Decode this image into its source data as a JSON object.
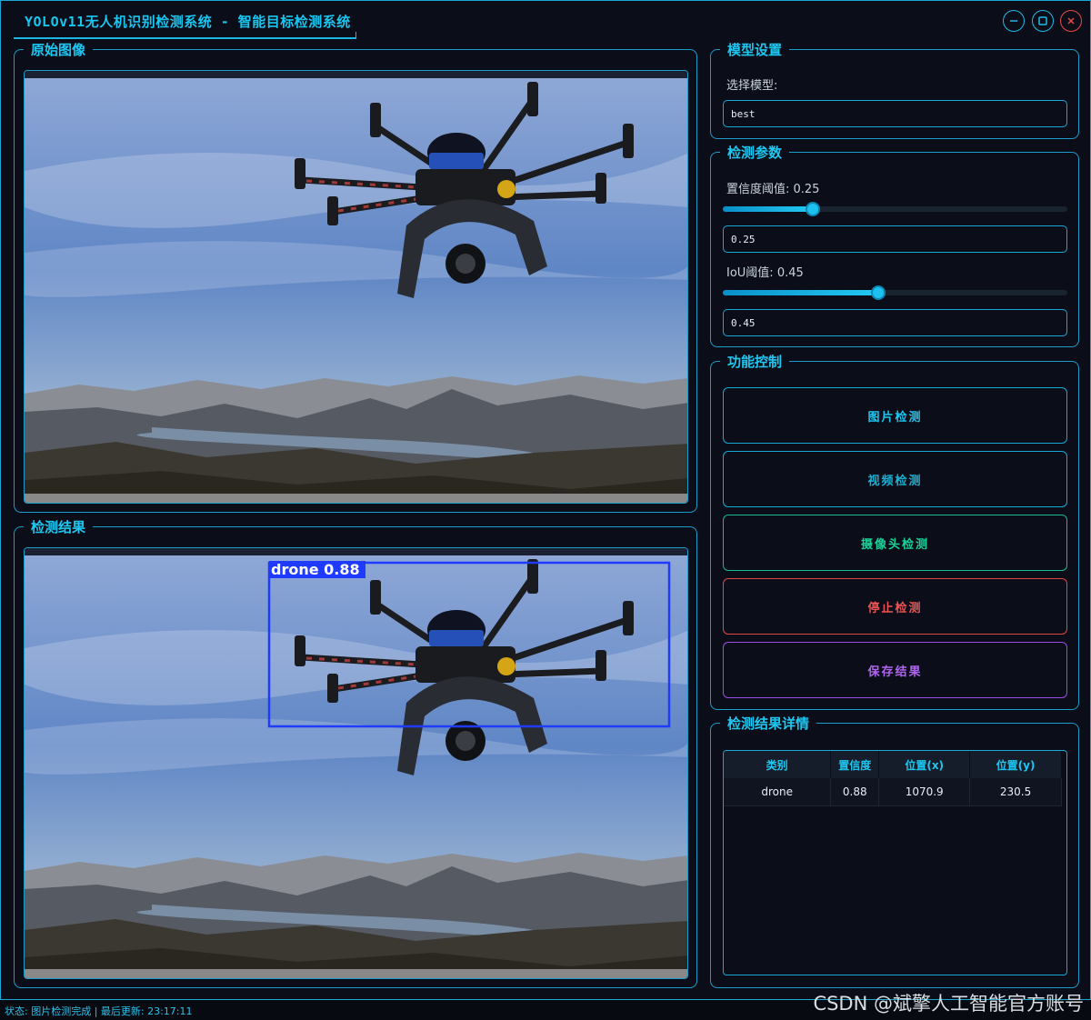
{
  "window": {
    "title": "YOLOv11无人机识别检测系统 - 智能目标检测系统"
  },
  "original_panel": {
    "title": "原始图像"
  },
  "result_panel": {
    "title": "检测结果",
    "detection_label": "drone 0.88",
    "box_color": "#1f3bff"
  },
  "model_settings": {
    "title": "模型设置",
    "select_label": "选择模型:",
    "selected_model": "best"
  },
  "detection_params": {
    "title": "检测参数",
    "confidence_label": "置信度阈值: 0.25",
    "confidence_value": "0.25",
    "confidence_fraction": 0.25,
    "iou_label": "IoU阈值: 0.45",
    "iou_value": "0.45",
    "iou_fraction": 0.45
  },
  "controls": {
    "title": "功能控制",
    "image_detect": "图片检测",
    "video_detect": "视频检测",
    "camera_detect": "摄像头检测",
    "stop_detect": "停止检测",
    "save_results": "保存结果"
  },
  "results_table": {
    "title": "检测结果详情",
    "columns": [
      "类别",
      "置信度",
      "位置(x)",
      "位置(y)"
    ],
    "rows": [
      [
        "drone",
        "0.88",
        "1070.9",
        "230.5"
      ]
    ]
  },
  "status_bar": {
    "text": "状态: 图片检测完成 | 最后更新: 23:17:11"
  },
  "watermark": "CSDN @斌擎人工智能官方账号",
  "colors": {
    "accent": "#1ec7f2",
    "camera": "#19d39b",
    "stop": "#ef5454",
    "save": "#b064f2"
  }
}
